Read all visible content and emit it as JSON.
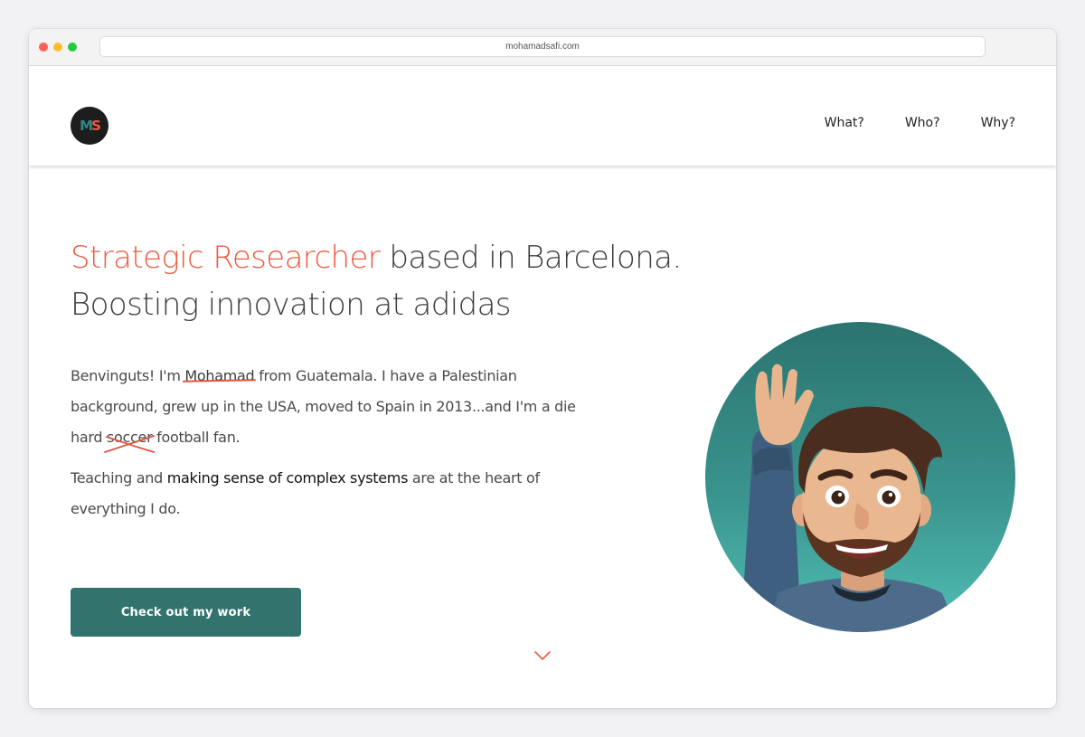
{
  "browser": {
    "url": "mohamadsafi.com"
  },
  "header": {
    "logo_m": "M",
    "logo_s": "S",
    "nav": [
      {
        "label": "What?"
      },
      {
        "label": "Who?"
      },
      {
        "label": "Why?"
      }
    ]
  },
  "hero": {
    "title_accent": "Strategic Researcher",
    "title_rest": " based in Barcelona.",
    "title_line2": "Boosting innovation at adidas",
    "p1_a": "Benvinguts! I'm ",
    "p1_name": "Mohamad",
    "p1_b": " from Guatemala. I have a Palestinian background, grew up in the USA, moved to Spain in 2013...and I'm a die hard ",
    "p1_struck": "soccer",
    "p1_c": " football fan.",
    "p2_a": "Teaching and ",
    "p2_strong": "making sense of complex systems",
    "p2_b": " are at the heart of everything I do.",
    "cta_label": "Check out my work"
  },
  "colors": {
    "accent": "#ef5b40",
    "cta": "#32736e",
    "avatar_bg": "#3a938d"
  },
  "icons": {
    "scroll": "chevron-down-icon",
    "avatar": "memoji-avatar"
  }
}
